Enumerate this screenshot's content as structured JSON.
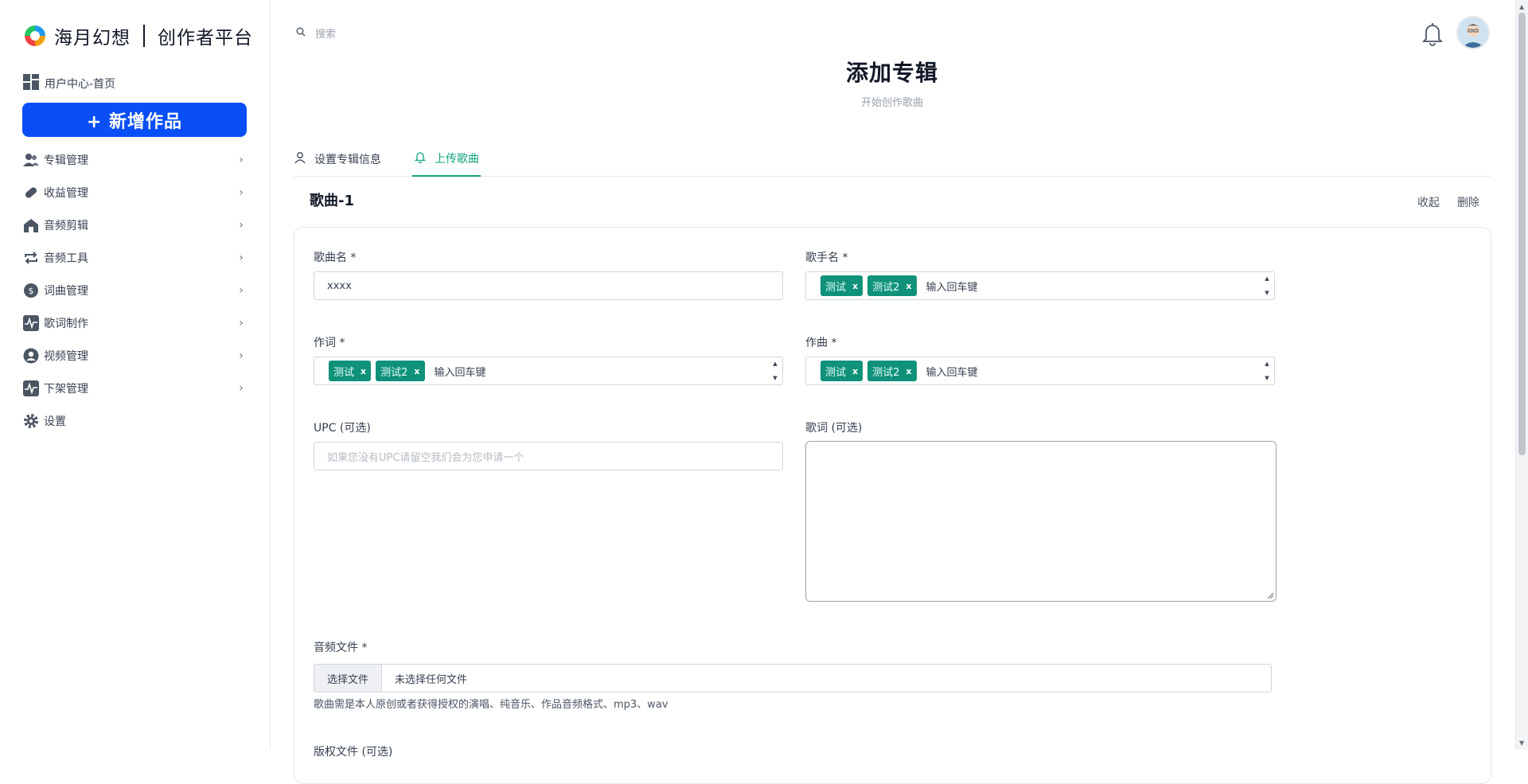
{
  "sidebar": {
    "brand": "海月幻想",
    "platform": "创作者平台",
    "home_label": "用户中心-首页",
    "new_work_label": "+ 新增作品",
    "items": [
      {
        "label": "专辑管理",
        "icon": "users-icon"
      },
      {
        "label": "收益管理",
        "icon": "pill-icon"
      },
      {
        "label": "音频剪辑",
        "icon": "house-icon"
      },
      {
        "label": "音频工具",
        "icon": "repeat-icon"
      },
      {
        "label": "词曲管理",
        "icon": "dollar-circle-icon"
      },
      {
        "label": "歌词制作",
        "icon": "pulse-icon"
      },
      {
        "label": "视频管理",
        "icon": "user-circle-icon"
      },
      {
        "label": "下架管理",
        "icon": "pulse-icon"
      },
      {
        "label": "设置",
        "icon": "gear-icon"
      }
    ]
  },
  "header": {
    "search_placeholder": "搜索",
    "title": "添加专辑",
    "subtitle": "开始创作歌曲"
  },
  "tabs": [
    {
      "label": "设置专辑信息",
      "active": false
    },
    {
      "label": "上传歌曲",
      "active": true
    }
  ],
  "song": {
    "heading": "歌曲-1",
    "collapse_label": "收起",
    "delete_label": "删除",
    "fields": {
      "song_name": {
        "label": "歌曲名 *",
        "value": "xxxx"
      },
      "singer": {
        "label": "歌手名 *",
        "tags": [
          "测试",
          "测试2"
        ],
        "placeholder": "输入回车键"
      },
      "lyricist": {
        "label": "作词 *",
        "tags": [
          "测试",
          "测试2"
        ],
        "placeholder": "输入回车键"
      },
      "composer": {
        "label": "作曲 *",
        "tags": [
          "测试",
          "测试2"
        ],
        "placeholder": "输入回车键"
      },
      "upc": {
        "label": "UPC (可选)",
        "placeholder": "如果您没有UPC请留空我们会为您申请一个"
      },
      "lyrics": {
        "label": "歌词 (可选)",
        "value": ""
      },
      "audio": {
        "label": "音频文件 *",
        "button": "选择文件",
        "file": "未选择任何文件",
        "hint": "歌曲需是本人原创或者获得授权的演唱、纯音乐、作品音频格式、mp3、wav"
      },
      "copyright": {
        "label": "版权文件 (可选)"
      }
    }
  },
  "colors": {
    "primary": "#0a4ff5",
    "accent": "#10a37f",
    "tag": "#10917a"
  }
}
